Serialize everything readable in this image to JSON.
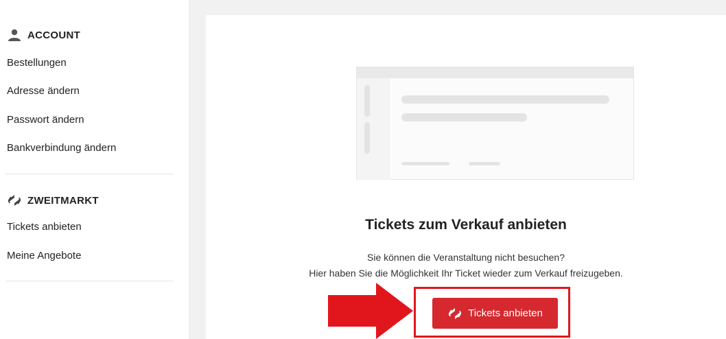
{
  "sidebar": {
    "account": {
      "heading": "ACCOUNT",
      "icon": "person-icon",
      "items": [
        {
          "label": "Bestellungen"
        },
        {
          "label": "Adresse ändern"
        },
        {
          "label": "Passwort ändern"
        },
        {
          "label": "Bankverbindung ändern"
        }
      ]
    },
    "zweitmarkt": {
      "heading": "ZWEITMARKT",
      "icon": "ticket-transfer-icon",
      "items": [
        {
          "label": "Tickets anbieten"
        },
        {
          "label": "Meine Angebote"
        }
      ]
    }
  },
  "main": {
    "title": "Tickets zum Verkauf anbieten",
    "subtitle_line1": "Sie können die Veranstaltung nicht besuchen?",
    "subtitle_line2": "Hier haben Sie die Möglichkeit Ihr Ticket wieder zum Verkauf freizugeben.",
    "cta_label": "Tickets anbieten",
    "cta_icon": "ticket-transfer-icon"
  },
  "colors": {
    "accent": "#d5292f",
    "highlight": "#e0161c",
    "panel_bg": "#f1f1f1"
  }
}
